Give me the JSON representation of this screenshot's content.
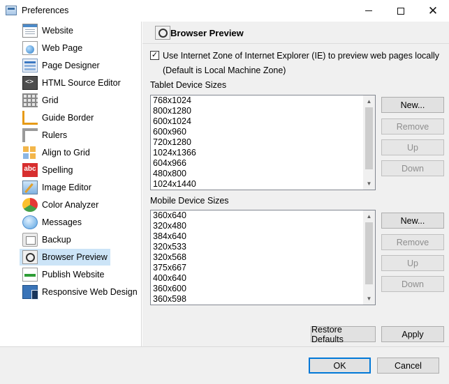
{
  "window": {
    "title": "Preferences",
    "minimize_icon": "minimize-icon",
    "maximize_icon": "maximize-icon",
    "close_glyph": "✕"
  },
  "sidebar": {
    "items": [
      {
        "label": "Website",
        "icon": "website-icon"
      },
      {
        "label": "Web Page",
        "icon": "web-page-icon"
      },
      {
        "label": "Page Designer",
        "icon": "page-designer-icon"
      },
      {
        "label": "HTML Source Editor",
        "icon": "html-source-editor-icon"
      },
      {
        "label": "Grid",
        "icon": "grid-icon"
      },
      {
        "label": "Guide Border",
        "icon": "guide-border-icon"
      },
      {
        "label": "Rulers",
        "icon": "rulers-icon"
      },
      {
        "label": "Align to Grid",
        "icon": "align-to-grid-icon"
      },
      {
        "label": "Spelling",
        "icon": "spelling-icon",
        "icon_text": "abc"
      },
      {
        "label": "Image Editor",
        "icon": "image-editor-icon"
      },
      {
        "label": "Color Analyzer",
        "icon": "color-analyzer-icon"
      },
      {
        "label": "Messages",
        "icon": "messages-icon"
      },
      {
        "label": "Backup",
        "icon": "backup-icon"
      },
      {
        "label": "Browser Preview",
        "icon": "browser-preview-icon",
        "selected": true
      },
      {
        "label": "Publish Website",
        "icon": "publish-website-icon"
      },
      {
        "label": "Responsive Web Design",
        "icon": "responsive-web-design-icon"
      }
    ]
  },
  "panel": {
    "title": "Browser Preview",
    "ie_zone": {
      "checked": true,
      "check_glyph": "✓",
      "label": "Use Internet Zone of Internet Explorer (IE) to preview web pages locally",
      "sublabel": "(Default is Local Machine Zone)"
    },
    "tablet": {
      "label": "Tablet Device Sizes",
      "items": [
        "768x1024",
        "800x1280",
        "600x1024",
        "600x960",
        "720x1280",
        "1024x1366",
        "604x966",
        "480x800",
        "1024x1440"
      ],
      "buttons": {
        "new": "New...",
        "remove": "Remove",
        "up": "Up",
        "down": "Down"
      }
    },
    "mobile": {
      "label": "Mobile Device Sizes",
      "items": [
        "360x640",
        "320x480",
        "384x640",
        "320x533",
        "320x568",
        "375x667",
        "400x640",
        "360x600",
        "360x598"
      ],
      "buttons": {
        "new": "New...",
        "remove": "Remove",
        "up": "Up",
        "down": "Down"
      }
    },
    "restore_defaults": "Restore Defaults",
    "apply": "Apply"
  },
  "footer": {
    "ok": "OK",
    "cancel": "Cancel"
  },
  "colors": {
    "selection": "#cce4f7",
    "panel_bg": "#f0f0f0",
    "default_button_border": "#0078d7"
  }
}
